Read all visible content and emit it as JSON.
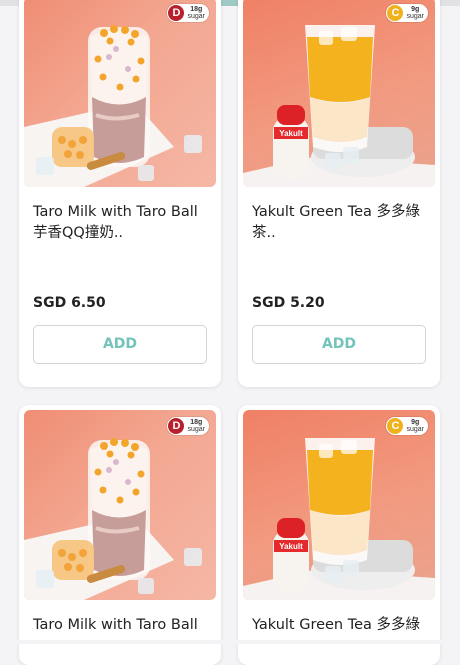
{
  "colors": {
    "background": "#f4f4f6",
    "card": "#ffffff",
    "accent": "#74c3bb",
    "badge_d": "#b8202e",
    "badge_c": "#efb21d"
  },
  "products": [
    {
      "name": "Taro Milk with Taro Ball 芋香QQ撞奶..",
      "price": "SGD 6.50",
      "add_label": "ADD",
      "grade": "D",
      "sugar_value": "18g",
      "sugar_unit": "sugar",
      "image": "taro-milk-drink-photo"
    },
    {
      "name": "Yakult Green Tea 多多綠茶..",
      "price": "SGD 5.20",
      "add_label": "ADD",
      "grade": "C",
      "sugar_value": "9g",
      "sugar_unit": "sugar",
      "image": "yakult-green-tea-drink-photo"
    },
    {
      "name": "Taro Milk with Taro Ball",
      "grade": "D",
      "sugar_value": "18g",
      "sugar_unit": "sugar",
      "image": "taro-milk-drink-photo"
    },
    {
      "name": "Yakult Green Tea 多多綠",
      "grade": "C",
      "sugar_value": "9g",
      "sugar_unit": "sugar",
      "image": "yakult-green-tea-drink-photo",
      "bottle_label": "Yakult"
    }
  ]
}
